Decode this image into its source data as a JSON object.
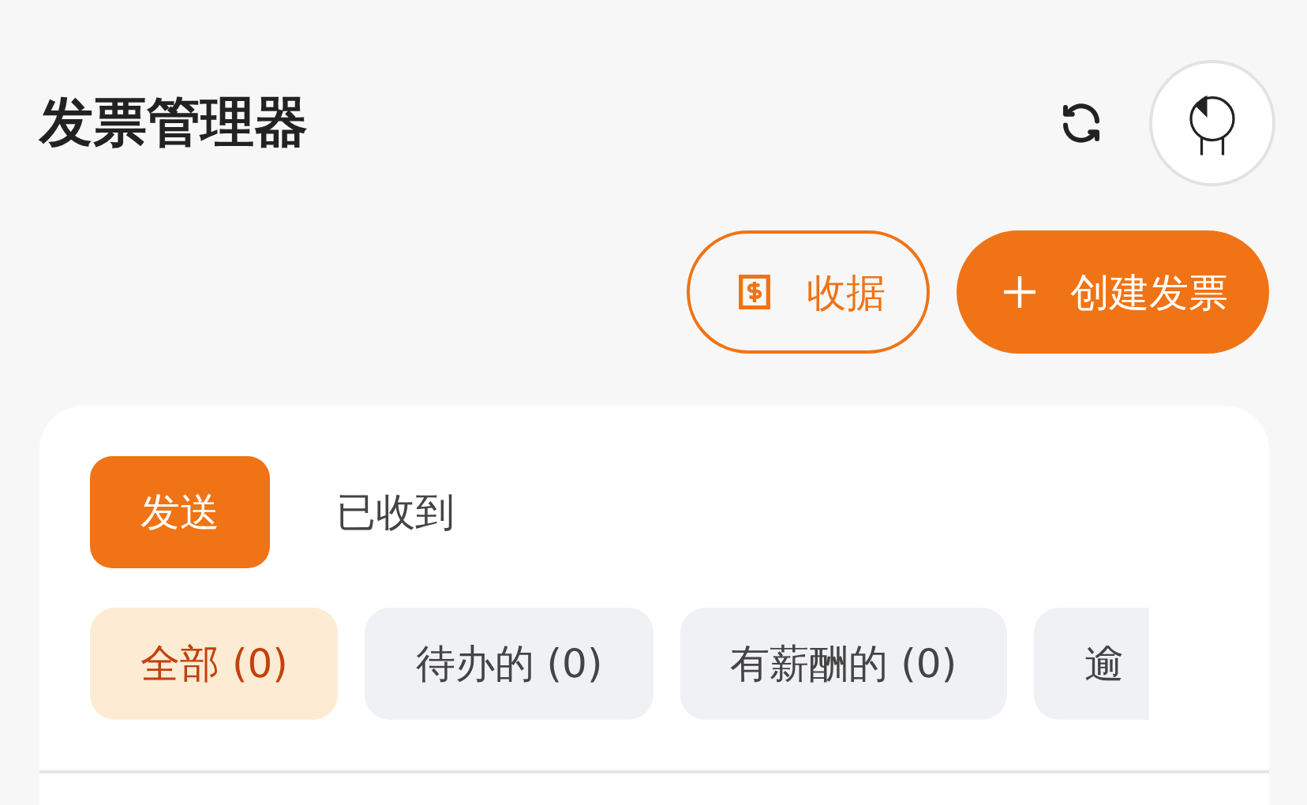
{
  "header": {
    "title": "发票管理器"
  },
  "actions": [
    {
      "kind": "outline",
      "label": "收据"
    },
    {
      "kind": "primary",
      "label": "创建发票"
    }
  ],
  "tabs": [
    {
      "label": "发送",
      "selected": true
    },
    {
      "label": "已收到",
      "selected": false
    }
  ],
  "filters": [
    {
      "label": "全部 (0)",
      "selected": true
    },
    {
      "label": "待办的 (0)",
      "selected": false
    },
    {
      "label": "有薪酬的 (0)",
      "selected": false
    },
    {
      "label": "逾",
      "selected": false
    }
  ]
}
